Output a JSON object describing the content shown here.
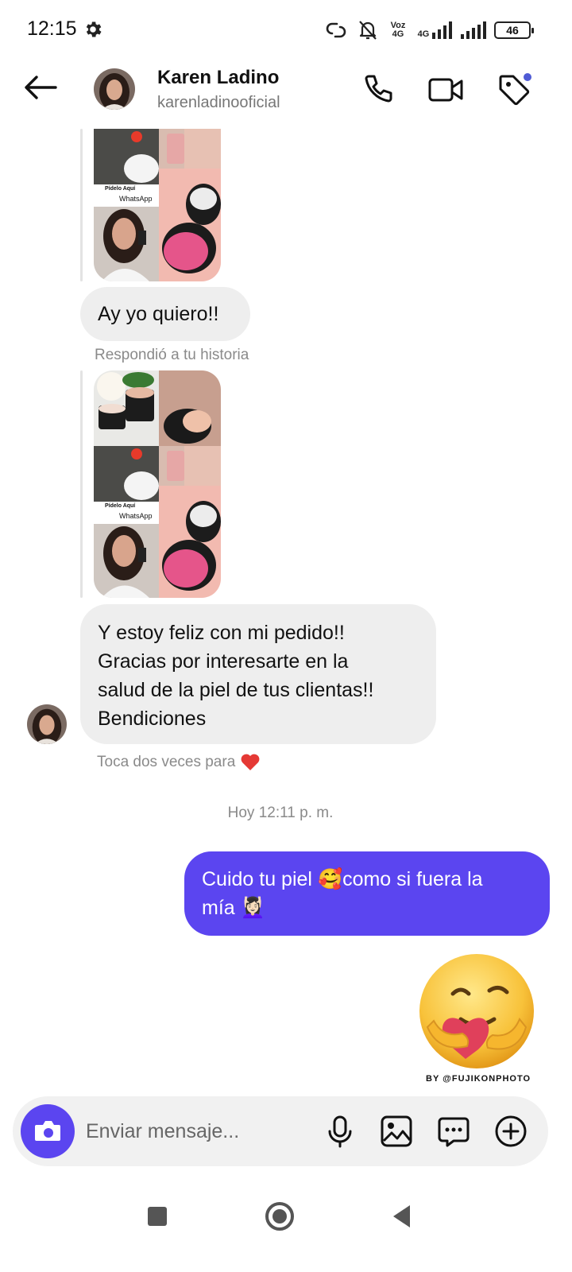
{
  "status_bar": {
    "time": "12:15",
    "network_label_1": "Voz 4G",
    "network_label_2": "4G",
    "battery": "46"
  },
  "header": {
    "contact_name": "Karen Ladino",
    "contact_handle": "karenladinooficial"
  },
  "story_image": {
    "overlay_text": "Pídelo Aquí",
    "whatsapp_text": "WhatsApp"
  },
  "messages": {
    "reply_1": "Ay yo quiero!!",
    "story_reply_label": "Respondió a tu historia",
    "reply_2": "Y estoy feliz con mi pedido!! Gracias por interesarte en la salud de la piel de tus clientas!! Bendiciones",
    "reply_2_lines": [
      "Y estoy feliz con mi pedido!!",
      "Gracias por interesarte en la",
      "salud de la piel de tus clientas!!",
      "Bendiciones"
    ],
    "double_tap_hint": "Toca dos veces para",
    "timestamp": "Hoy 12:11 p. m.",
    "sent_1_part1": "Cuido tu piel ",
    "sent_1_emoji1": "🥰",
    "sent_1_part2": "como si fuera la",
    "sent_1_part3": "mía ",
    "sent_1_emoji2": "💆🏻‍♀️",
    "sticker_credit": "BY @FUJIKONPHOTO"
  },
  "composer": {
    "placeholder": "Enviar mensaje..."
  },
  "colors": {
    "accent": "#5b45f0",
    "incoming_bubble": "#eeeeee",
    "meta_text": "#8a8a8a",
    "notification_dot": "#4f5bd5",
    "heart": "#e53935"
  }
}
